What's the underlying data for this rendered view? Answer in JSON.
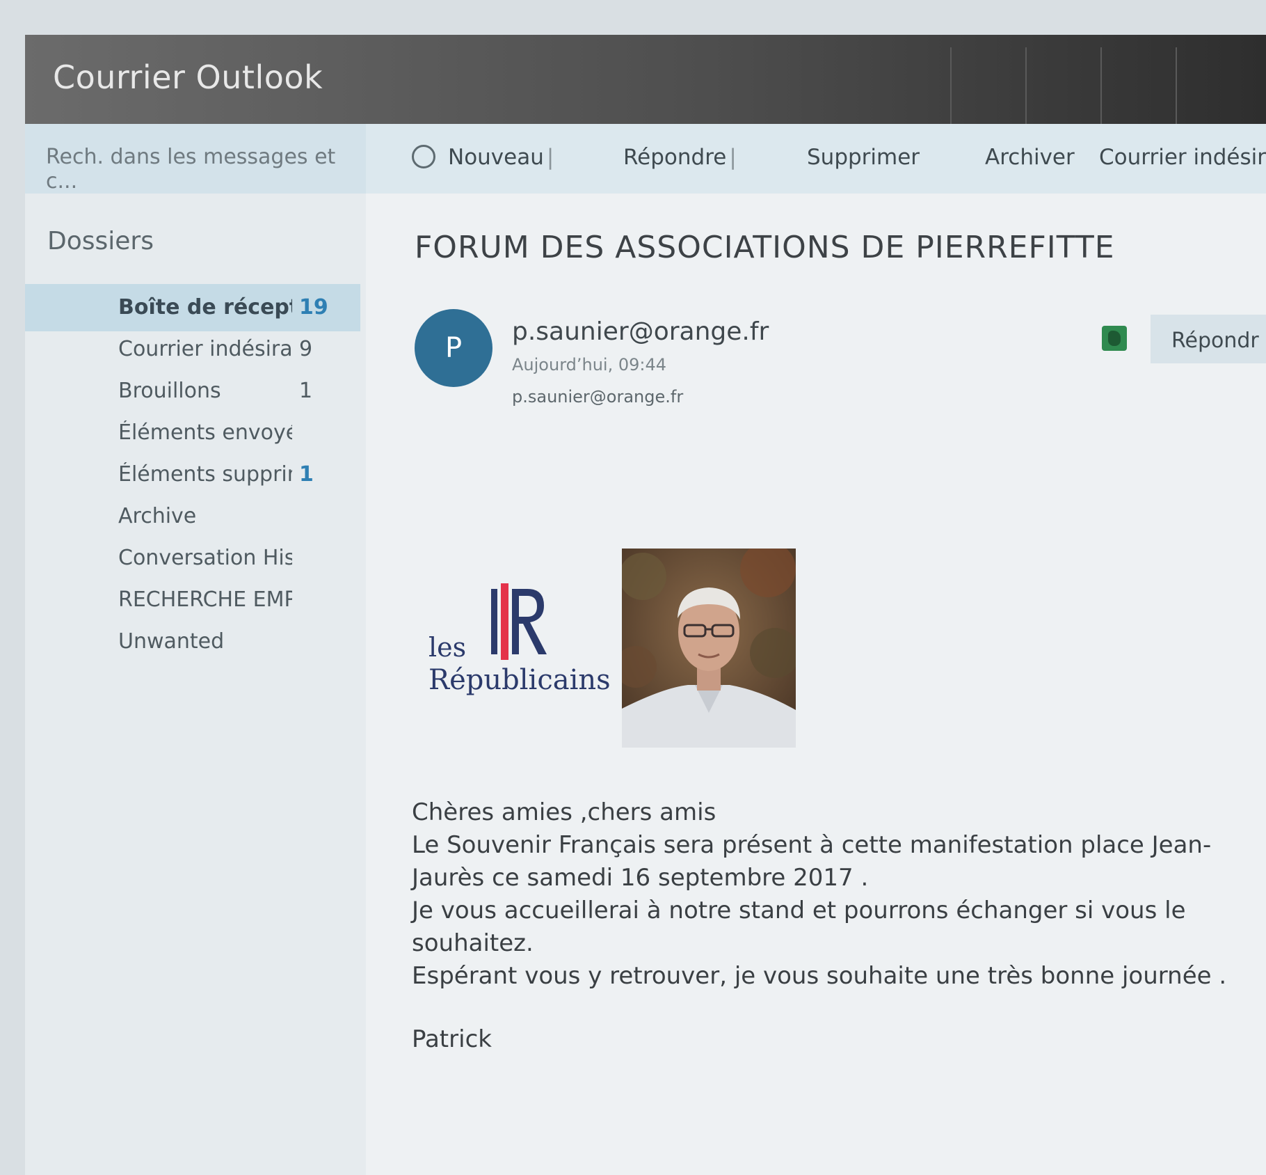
{
  "app": {
    "title": "Courrier Outlook"
  },
  "search": {
    "placeholder": "Rech. dans les messages et c..."
  },
  "toolbar": {
    "new_label": "Nouveau",
    "reply_label": "Répondre",
    "delete_label": "Supprimer",
    "archive_label": "Archiver",
    "junk_label": "Courrier indésira",
    "separator": "|"
  },
  "sidebar": {
    "heading": "Dossiers",
    "folders": [
      {
        "label": "Boîte de récept",
        "count": "19"
      },
      {
        "label": "Courrier indésirab",
        "count": "9"
      },
      {
        "label": "Brouillons",
        "count": "1"
      },
      {
        "label": "Éléments envoyés",
        "count": ""
      },
      {
        "label": "Éléments supprim",
        "count": "1"
      },
      {
        "label": "Archive",
        "count": ""
      },
      {
        "label": "Conversation Histor",
        "count": ""
      },
      {
        "label": "RECHERCHE EMPLO",
        "count": ""
      },
      {
        "label": "Unwanted",
        "count": ""
      }
    ]
  },
  "message": {
    "subject": "FORUM DES ASSOCIATIONS DE PIERREFITTE",
    "avatar_initial": "P",
    "sender": "p.saunier@orange.fr",
    "time": "Aujourd’hui, 09:44",
    "recipient": "p.saunier@orange.fr",
    "reply_label": "Répondr",
    "logo": {
      "small": "les",
      "big": "Républicains",
      "mark": "LR"
    },
    "body": [
      "Chères amies ,chers amis",
      "Le Souvenir Français sera présent à cette manifestation place Jean-Jaurès ce samedi 16 septembre 2017 .",
      "Je vous accueillerai à notre stand et pourrons échanger si vous le souhaitez.",
      "Espérant vous y retrouver, je vous souhaite une très bonne journée ."
    ],
    "signature": "Patrick"
  },
  "colors": {
    "accent": "#2e7fb3",
    "avatar": "#2f6f95",
    "selected_folder": "#c5dbe6",
    "logo_blue": "#2b3a6b",
    "logo_red": "#e4324a"
  }
}
